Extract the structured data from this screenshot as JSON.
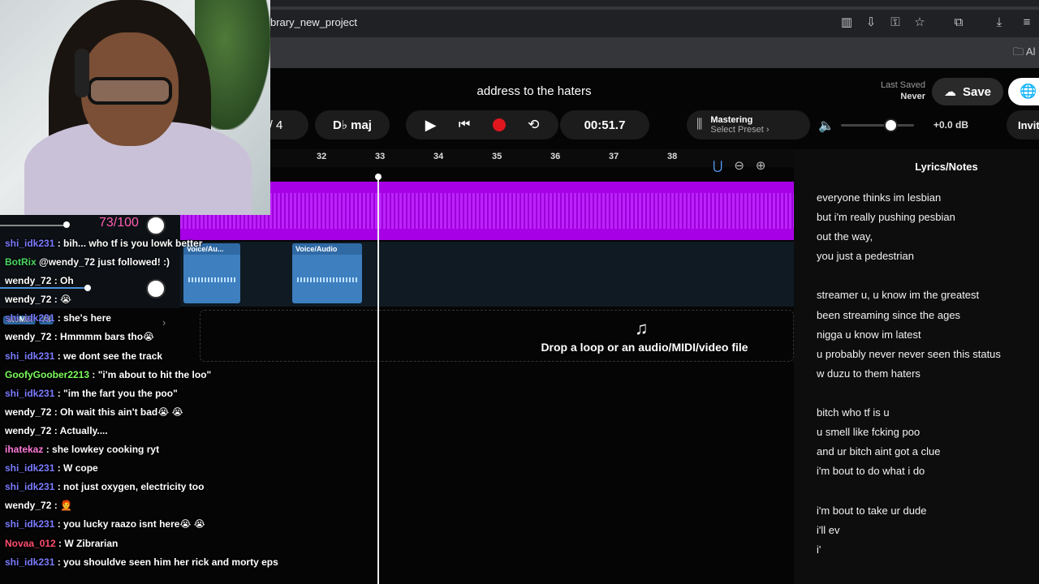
{
  "browser": {
    "url": "brary_new_project",
    "toolbar_icons": [
      "reader-icon",
      "install-icon",
      "key-icon",
      "star-icon",
      "extensions-icon",
      "download-icon",
      "menu-icon"
    ],
    "bookmark_label": "Al"
  },
  "header": {
    "title": "address to the haters",
    "last_saved_label": "Last Saved",
    "last_saved_value": "Never",
    "save_label": "Save"
  },
  "toolbar": {
    "bar_signature": "/ 4",
    "key": "D♭ maj",
    "time": "00:51.7",
    "mastering_label": "Mastering",
    "mastering_preset": "Select Preset ›",
    "volume_db": "+0.0 dB",
    "volume_level": 0.68,
    "invite_label": "Invit"
  },
  "ruler": {
    "bars": [
      "32",
      "33",
      "34",
      "35",
      "36",
      "37",
      "38"
    ]
  },
  "tracks": {
    "clips": [
      {
        "label": "Voice/Au..."
      },
      {
        "label": "Voice/Audio"
      }
    ],
    "drop_text": "Drop a loop or an audio/MIDI/video file"
  },
  "lyrics": {
    "title": "Lyrics/Notes",
    "lines": [
      "everyone thinks im lesbian",
      "but i'm really pushing pesbian",
      "out the way,",
      "you just a pedestrian",
      "",
      "streamer u, u know im the greatest",
      "been streaming since the ages",
      "nigga u know im latest",
      "u probably never never seen this status",
      "w duzu to them haters",
      "",
      "bitch who tf is u",
      "u smell like fcking poo",
      "and ur bitch aint got a clue",
      "i'm bout to do what i do",
      "",
      "i'm bout to take ur dude",
      "i'll ev",
      "i'"
    ]
  },
  "overlay": {
    "counter": "73/100",
    "automix": "utoMix",
    "automix_badge": "AI",
    "chat": [
      {
        "user": "shi_idk231",
        "color": "#7b7bff",
        "text": " : bih... who tf is you lowk better"
      },
      {
        "user": "BotRix",
        "color": "#4cd964",
        "text": " @wendy_72 just followed! :)"
      },
      {
        "user": "wendy_72",
        "color": "#ffffff",
        "text": " : Oh"
      },
      {
        "user": "wendy_72",
        "color": "#ffffff",
        "text": " : 😭"
      },
      {
        "user": "shi_idk231",
        "color": "#7b7bff",
        "text": " : she's here"
      },
      {
        "user": "wendy_72",
        "color": "#ffffff",
        "text": " : Hmmmm bars tho😭"
      },
      {
        "user": "shi_idk231",
        "color": "#7b7bff",
        "text": " : we dont see the track"
      },
      {
        "user": "GoofyGoober2213",
        "color": "#7cfc5a",
        "text": " : \"i'm about to hit the loo\""
      },
      {
        "user": "shi_idk231",
        "color": "#7b7bff",
        "text": " : \"im the fart you the poo\""
      },
      {
        "user": "wendy_72",
        "color": "#ffffff",
        "text": " : Oh wait this ain't bad😭 😭"
      },
      {
        "user": "wendy_72",
        "color": "#ffffff",
        "text": " : Actually...."
      },
      {
        "user": "ihatekaz",
        "color": "#ff7ad9",
        "text": " : she lowkey cooking ryt"
      },
      {
        "user": "shi_idk231",
        "color": "#7b7bff",
        "text": " : W cope"
      },
      {
        "user": "shi_idk231",
        "color": "#7b7bff",
        "text": " : not just oxygen, electricity too"
      },
      {
        "user": "wendy_72",
        "color": "#ffffff",
        "text": " : 🧑‍🦰"
      },
      {
        "user": "shi_idk231",
        "color": "#7b7bff",
        "text": " : you lucky raazo isnt here😭 😭"
      },
      {
        "user": "Novaa_012",
        "color": "#ff4d6d",
        "text": " : W Zibrarian"
      },
      {
        "user": "shi_idk231",
        "color": "#7b7bff",
        "text": " : you shouldve seen him her rick and morty eps"
      }
    ]
  },
  "colors": {
    "track_purple": "#a800e6",
    "clip_blue": "#3d7fbf",
    "record_red": "#e0161e",
    "magnet_blue": "#5aa0ff"
  }
}
